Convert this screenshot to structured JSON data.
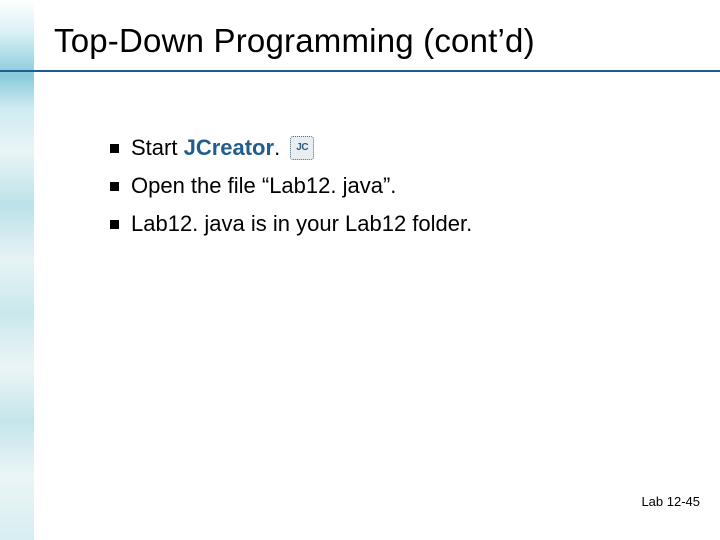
{
  "title": "Top-Down Programming (cont’d)",
  "bullets": {
    "b1": {
      "prefix": "Start ",
      "strong": "JCreator",
      "suffix": ". "
    },
    "b2": {
      "text": "Open the file “Lab12. java”."
    },
    "b3": {
      "text": "Lab12. java is in your Lab12 folder."
    }
  },
  "icon": {
    "jc_label": "JC"
  },
  "footer": {
    "lab_label": "Lab ",
    "lab_number": "12-45"
  }
}
